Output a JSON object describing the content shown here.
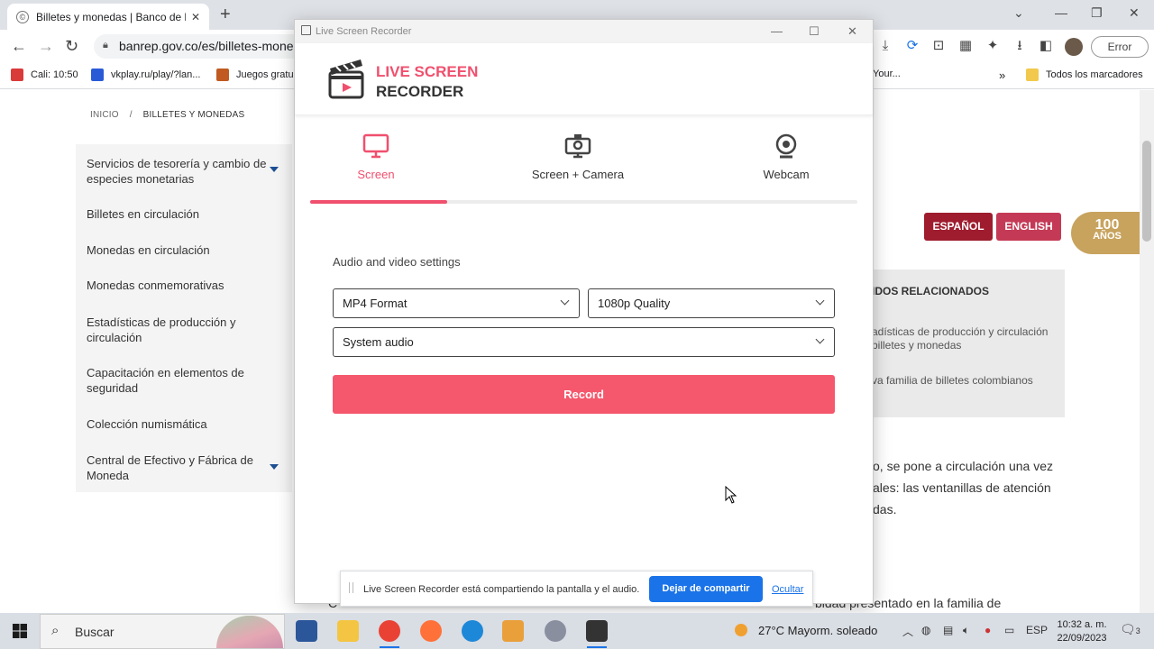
{
  "browser": {
    "tab_title": "Billetes y monedas | Banco de la",
    "url": "banrep.gov.co/es/billetes-moned",
    "error_label": "Error",
    "bookmarks": [
      {
        "label": "Cali: 10:50",
        "color": "#d93a3a"
      },
      {
        "label": "vkplay.ru/play/?lan...",
        "color": "#2a5bd7"
      },
      {
        "label": "Juegos gratu",
        "color": "#c05a20"
      }
    ],
    "bookmark_right": "Your...",
    "all_bookmarks": "Todos los marcadores"
  },
  "page": {
    "breadcrumb": {
      "home": "INICIO",
      "sep": "/",
      "current": "BILLETES Y MONEDAS"
    },
    "nav": [
      "Servicios de tesorería y cambio de especies monetarias",
      "Billetes en circulación",
      "Monedas en circulación",
      "Monedas conmemorativas",
      "Estadísticas de producción y circulación",
      "Capacitación en elementos de seguridad",
      "Colección numismática",
      "Central de Efectivo y Fábrica de Moneda"
    ],
    "lang_es": "ESPAÑOL",
    "lang_en": "ENGLISH",
    "badge_line1": "100",
    "badge_line2": "AÑOS",
    "related_title": "IDOS RELACIONADOS",
    "related_items": [
      "adísticas de producción y circulación billetes y monedas",
      "va familia de billetes colombianos"
    ],
    "body_lines": [
      "o, se pone a circulación una vez",
      "ales: las ventanillas de atención",
      "das."
    ],
    "bottom_left": "C",
    "bottom_right": "bidad presentado en la familia de"
  },
  "recorder": {
    "window_title": "Live Screen Recorder",
    "logo_line1": "LIVE SCREEN",
    "logo_line2": "RECORDER",
    "modes": [
      {
        "label": "Screen",
        "icon": "monitor-icon",
        "active": true
      },
      {
        "label": "Screen + Camera",
        "icon": "screen-camera-icon",
        "active": false
      },
      {
        "label": "Webcam",
        "icon": "webcam-icon",
        "active": false
      }
    ],
    "progress": 0.25,
    "settings_label": "Audio and video settings",
    "format": "MP4 Format",
    "quality": "1080p Quality",
    "audio": "System audio",
    "record_label": "Record",
    "accent": "#f5576c"
  },
  "sharebar": {
    "message": "Live Screen Recorder está compartiendo la pantalla y el audio.",
    "stop_label": "Dejar de compartir",
    "hide_label": "Ocultar"
  },
  "taskbar": {
    "search_label": "Buscar",
    "weather": "27°C  Mayorm. soleado",
    "lang": "ESP",
    "time": "10:32 a. m.",
    "date": "22/09/2023",
    "notif_count": "3"
  }
}
